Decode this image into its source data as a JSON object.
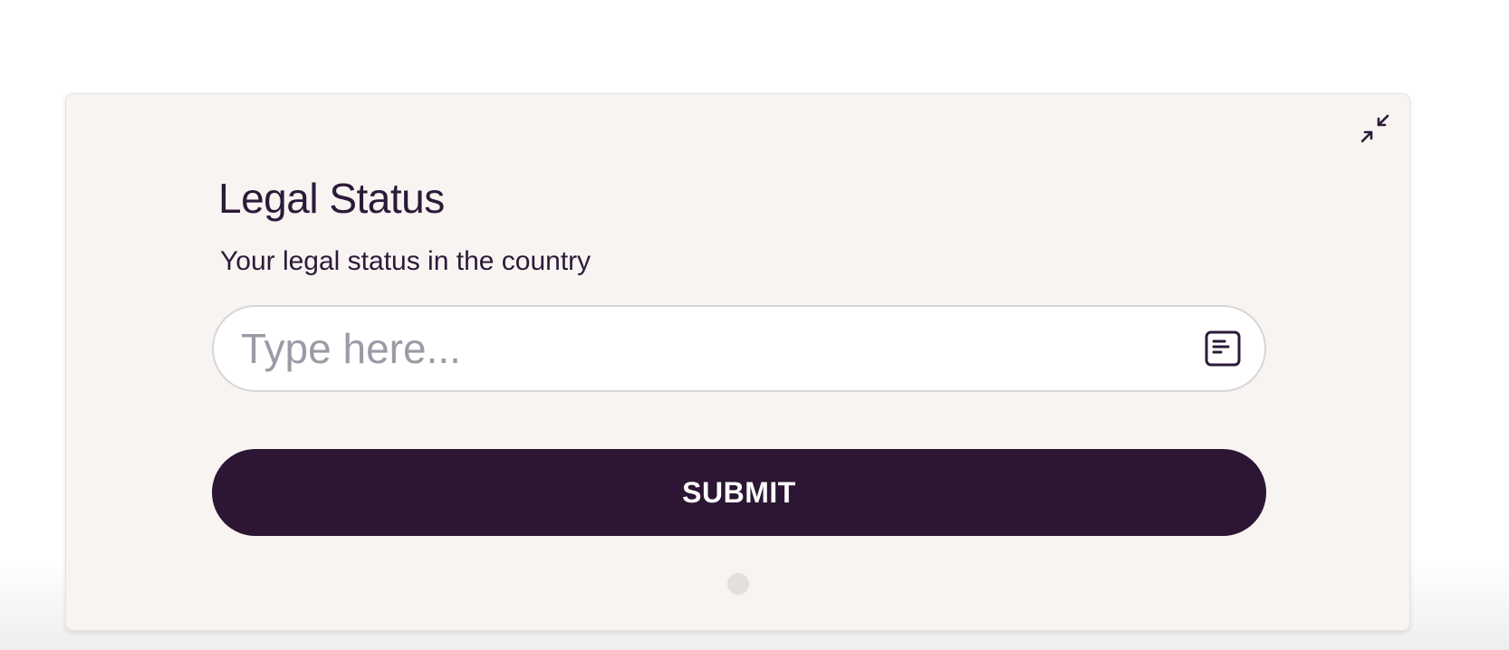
{
  "card": {
    "title": "Legal Status",
    "description": "Your legal status in the country",
    "input": {
      "placeholder": "Type here...",
      "value": ""
    },
    "submit_label": "SUBMIT",
    "icons": {
      "collapse": "collapse-arrows-icon",
      "input": "short-text-icon"
    }
  },
  "progress": {
    "total_steps": 1,
    "current_step": 1
  },
  "colors": {
    "card_background": "#f8f4f2",
    "primary": "#2c1633",
    "text": "#2c1a38",
    "placeholder": "#9a9ba5"
  }
}
